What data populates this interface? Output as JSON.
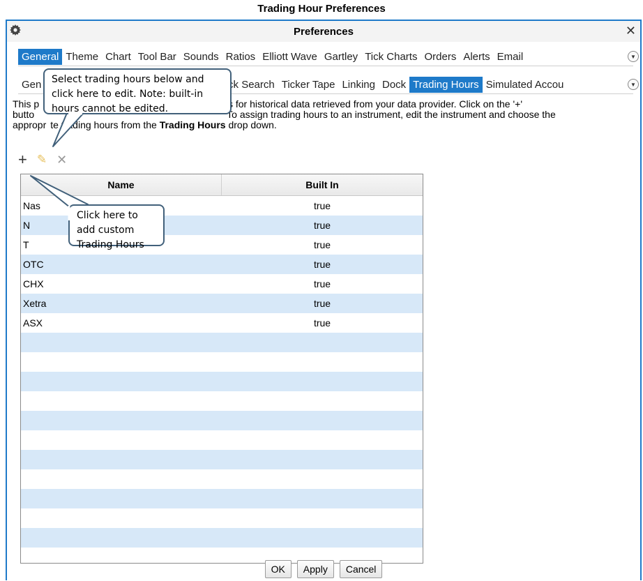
{
  "doc_title": "Trading Hour Preferences",
  "window": {
    "title": "Preferences"
  },
  "tabs_main": [
    {
      "label": "General",
      "active": true
    },
    {
      "label": "Theme"
    },
    {
      "label": "Chart"
    },
    {
      "label": "Tool Bar"
    },
    {
      "label": "Sounds"
    },
    {
      "label": "Ratios"
    },
    {
      "label": "Elliott Wave"
    },
    {
      "label": "Gartley"
    },
    {
      "label": "Tick Charts"
    },
    {
      "label": "Orders"
    },
    {
      "label": "Alerts"
    },
    {
      "label": "Email"
    }
  ],
  "tabs_sub": [
    {
      "label": "Gen"
    },
    {
      "label": "uick Search"
    },
    {
      "label": "Ticker Tape"
    },
    {
      "label": "Linking"
    },
    {
      "label": "Dock"
    },
    {
      "label": "Trading Hours",
      "active": true
    },
    {
      "label": "Simulated Accou"
    }
  ],
  "description": {
    "line1_a": "This p",
    "line1_b": "rading hours for historical data retrieved from your data provider.  Click on the '+'",
    "line2_a": "butto",
    "line2_b": "To assign trading hours to an instrument, edit the instrument and choose the",
    "line3_a": "appropr",
    "line3_b": "te trading hours from the ",
    "line3_bold": "Trading Hours",
    "line3_c": " drop down."
  },
  "toolbar": {
    "add": "+",
    "edit": "✎",
    "delete": "✕"
  },
  "table": {
    "columns": [
      "Name",
      "Built In"
    ],
    "rows": [
      [
        "Nas",
        "true"
      ],
      [
        "N",
        "true"
      ],
      [
        "T",
        "true"
      ],
      [
        "OTC",
        "true"
      ],
      [
        "CHX",
        "true"
      ],
      [
        "Xetra",
        "true"
      ],
      [
        "ASX",
        "true"
      ],
      [
        "",
        ""
      ],
      [
        "",
        ""
      ],
      [
        "",
        ""
      ],
      [
        "",
        ""
      ],
      [
        "",
        ""
      ],
      [
        "",
        ""
      ],
      [
        "",
        ""
      ],
      [
        "",
        ""
      ],
      [
        "",
        ""
      ],
      [
        "",
        ""
      ],
      [
        "",
        ""
      ],
      [
        "",
        ""
      ]
    ]
  },
  "buttons": {
    "ok": "OK",
    "apply": "Apply",
    "cancel": "Cancel"
  },
  "callouts": {
    "edit_hint": "Select trading hours below and click here to edit.  Note: built-in hours cannot be edited.",
    "add_hint": "Click here to add custom Trading Hours"
  },
  "icons": {
    "gear": "gear-icon",
    "close": "close-icon",
    "overflow": "chevron-down-icon"
  },
  "colors": {
    "accent": "#1e7ac9",
    "row_alt": "#d7e8f8",
    "callout_border": "#41607a"
  }
}
